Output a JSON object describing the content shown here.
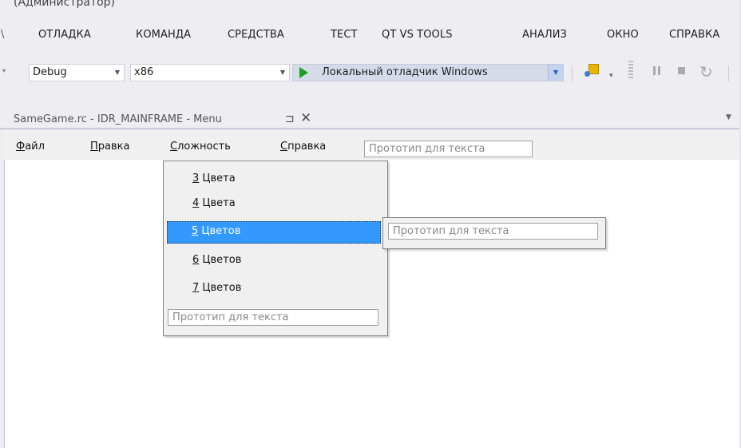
{
  "window": {
    "title_fragment": "(Администратор)"
  },
  "main_menu": {
    "items": [
      "ОТЛАДКА",
      "КОМАНДА",
      "СРЕДСТВА",
      "ТЕСТ",
      "QT VS TOOLS",
      "АНАЛИЗ",
      "ОКНО",
      "СПРАВКА"
    ]
  },
  "toolbar": {
    "config_value": "Debug",
    "platform_value": "x86",
    "run_label": "Локальный отладчик Windows"
  },
  "doc_tab": {
    "title": "SameGame.rc - IDR_MAINFRAME - Menu",
    "pin_glyph": "⊐",
    "close_glyph": "✕"
  },
  "designer_menu": {
    "items": [
      {
        "accel": "Ф",
        "rest": "айл"
      },
      {
        "accel": "П",
        "rest": "равка"
      },
      {
        "accel": "С",
        "rest": "ложность"
      },
      {
        "accel": "С",
        "rest": "правка"
      }
    ],
    "prototype": "Прототип для текста"
  },
  "dropdown": {
    "items": [
      {
        "accel": "3",
        "rest": " Цвета"
      },
      {
        "accel": "4",
        "rest": " Цвета"
      },
      {
        "accel": "5",
        "rest": " Цветов"
      },
      {
        "accel": "6",
        "rest": " Цветов"
      },
      {
        "accel": "7",
        "rest": " Цветов"
      }
    ],
    "selected_index": 2,
    "prototype": "Прототип для текста"
  },
  "submenu": {
    "prototype": "Прототип для текста"
  },
  "colors": {
    "selection": "#3399ff",
    "run_button": "#d6dbe9",
    "play_icon": "#1e9f1e"
  }
}
